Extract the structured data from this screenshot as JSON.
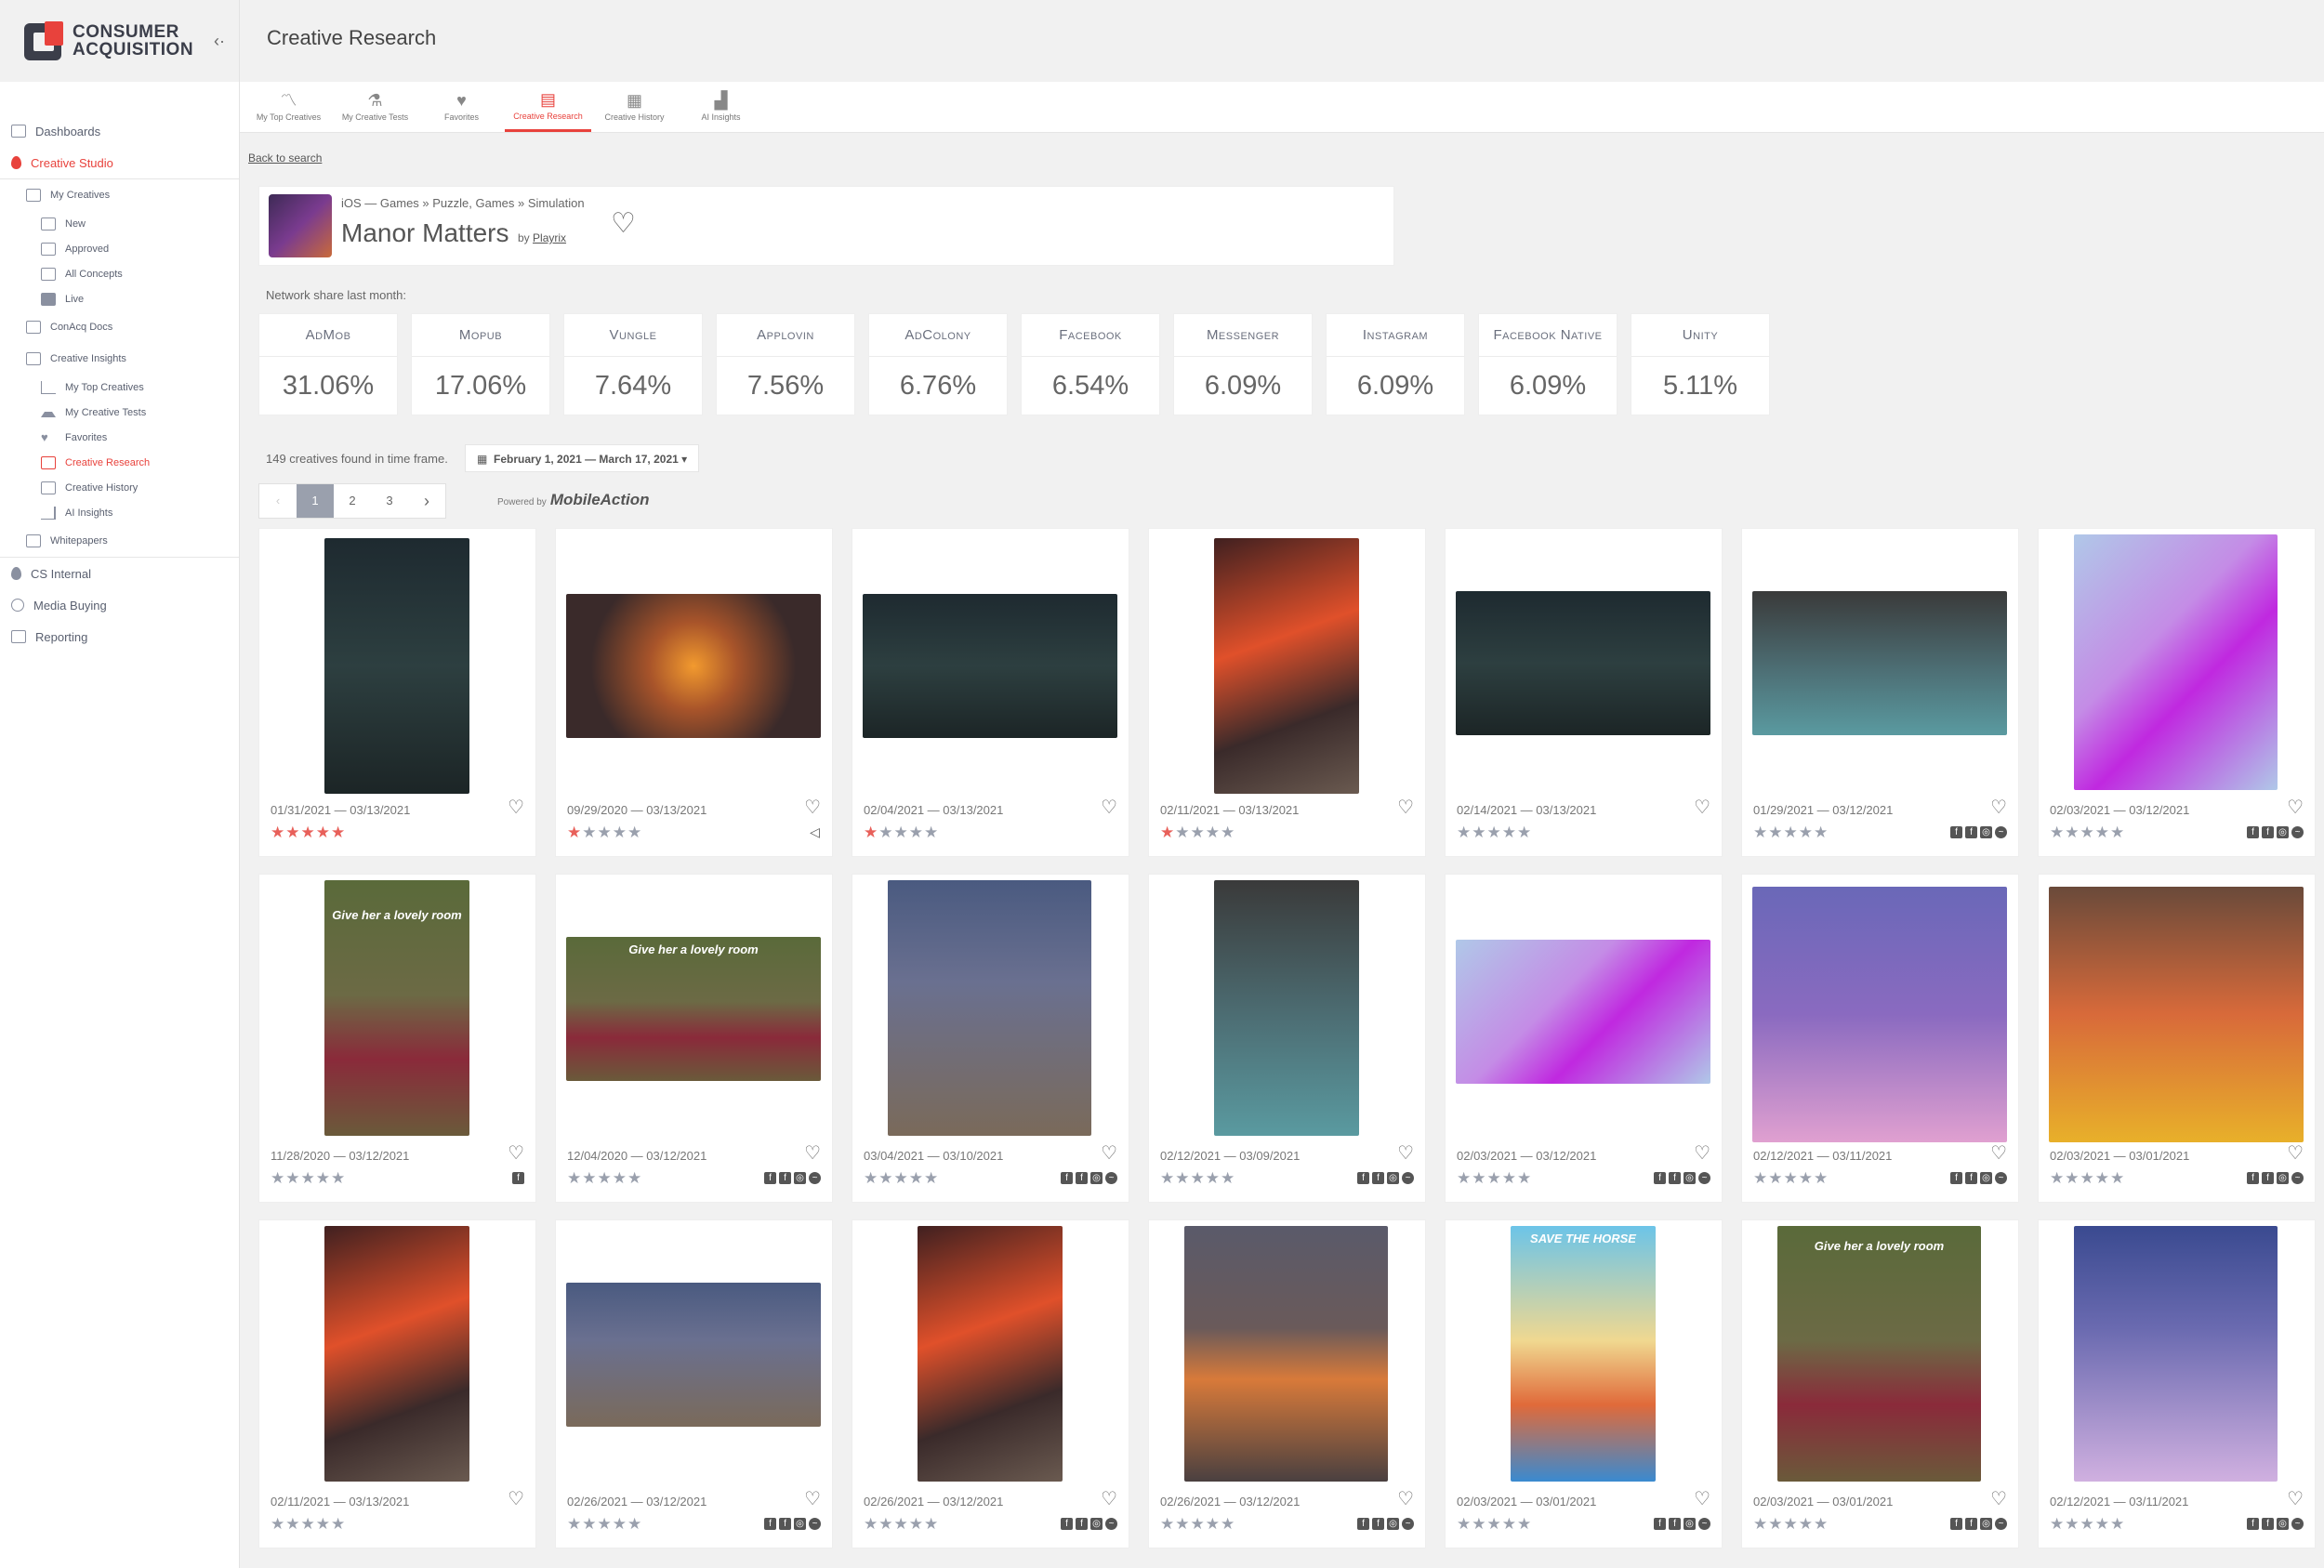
{
  "brand": {
    "line1": "CONSUMER",
    "line2": "ACQUISITION"
  },
  "page_title": "Creative Research",
  "sidebar": {
    "items": [
      {
        "label": "Dashboards"
      },
      {
        "label": "Creative Studio"
      },
      {
        "label": "My Creatives"
      },
      {
        "label": "New"
      },
      {
        "label": "Approved"
      },
      {
        "label": "All Concepts"
      },
      {
        "label": "Live"
      },
      {
        "label": "ConAcq Docs"
      },
      {
        "label": "Creative Insights"
      },
      {
        "label": "My Top Creatives"
      },
      {
        "label": "My Creative Tests"
      },
      {
        "label": "Favorites"
      },
      {
        "label": "Creative Research"
      },
      {
        "label": "Creative History"
      },
      {
        "label": "AI Insights"
      },
      {
        "label": "Whitepapers"
      },
      {
        "label": "CS Internal"
      },
      {
        "label": "Media Buying"
      },
      {
        "label": "Reporting"
      }
    ]
  },
  "tabs": [
    {
      "label": "My Top Creatives",
      "icon": "chart-line-icon"
    },
    {
      "label": "My Creative Tests",
      "icon": "flask-icon"
    },
    {
      "label": "Favorites",
      "icon": "heart-icon"
    },
    {
      "label": "Creative Research",
      "icon": "book-icon"
    },
    {
      "label": "Creative History",
      "icon": "calendar-icon"
    },
    {
      "label": "AI Insights",
      "icon": "bar-chart-icon"
    }
  ],
  "back_link": "Back to search",
  "app": {
    "breadcrumb": "iOS — Games » Puzzle, Games » Simulation",
    "name": "Manor Matters",
    "by_label": "by",
    "publisher": "Playrix"
  },
  "network_share": {
    "label": "Network share last month:",
    "items": [
      {
        "network": "AdMob",
        "value": "31.06%"
      },
      {
        "network": "Mopub",
        "value": "17.06%"
      },
      {
        "network": "Vungle",
        "value": "7.64%"
      },
      {
        "network": "Applovin",
        "value": "7.56%"
      },
      {
        "network": "AdColony",
        "value": "6.76%"
      },
      {
        "network": "Facebook",
        "value": "6.54%"
      },
      {
        "network": "Messenger",
        "value": "6.09%"
      },
      {
        "network": "Instagram",
        "value": "6.09%"
      },
      {
        "network": "Facebook Native",
        "value": "6.09%"
      },
      {
        "network": "Unity",
        "value": "5.11%"
      }
    ]
  },
  "results": {
    "found_text": "149 creatives found in time frame.",
    "date_range": "February 1, 2021 — March 17, 2021"
  },
  "pagination": {
    "pages": [
      "1",
      "2",
      "3"
    ],
    "current": "1"
  },
  "powered_by": {
    "label": "Powered by",
    "brand": "MobileAction"
  },
  "cards": [
    {
      "dates": "01/31/2021 — 03/13/2021",
      "stars": 5,
      "nets": []
    },
    {
      "dates": "09/29/2020 — 03/13/2021",
      "stars": 1,
      "nets": [
        "unity"
      ]
    },
    {
      "dates": "02/04/2021 — 03/13/2021",
      "stars": 1,
      "nets": []
    },
    {
      "dates": "02/11/2021 — 03/13/2021",
      "stars": 1,
      "nets": []
    },
    {
      "dates": "02/14/2021 — 03/13/2021",
      "stars": 0,
      "nets": []
    },
    {
      "dates": "01/29/2021 — 03/12/2021",
      "stars": 0,
      "nets": [
        "fb",
        "fb",
        "ig",
        "msg"
      ]
    },
    {
      "dates": "02/03/2021 — 03/12/2021",
      "stars": 0,
      "nets": [
        "fb",
        "fb",
        "ig",
        "msg"
      ]
    },
    {
      "dates": "11/28/2020 — 03/12/2021",
      "stars": 0,
      "nets": [
        "fb"
      ],
      "caption": "Give her a lovely room"
    },
    {
      "dates": "12/04/2020 — 03/12/2021",
      "stars": 0,
      "nets": [
        "fb",
        "fb",
        "ig",
        "msg"
      ],
      "caption": "Give her a lovely room"
    },
    {
      "dates": "03/04/2021 — 03/10/2021",
      "stars": 0,
      "nets": [
        "fb",
        "fb",
        "ig",
        "msg"
      ]
    },
    {
      "dates": "02/12/2021 — 03/09/2021",
      "stars": 0,
      "nets": [
        "fb",
        "fb",
        "ig",
        "msg"
      ]
    },
    {
      "dates": "02/03/2021 — 03/12/2021",
      "stars": 0,
      "nets": [
        "fb",
        "fb",
        "ig",
        "msg"
      ]
    },
    {
      "dates": "02/12/2021 — 03/11/2021",
      "stars": 0,
      "nets": [
        "fb",
        "fb",
        "ig",
        "msg"
      ]
    },
    {
      "dates": "02/03/2021 — 03/01/2021",
      "stars": 0,
      "nets": [
        "fb",
        "fb",
        "ig",
        "msg"
      ]
    },
    {
      "dates": "02/11/2021 — 03/13/2021",
      "stars": 0,
      "nets": []
    },
    {
      "dates": "02/26/2021 — 03/12/2021",
      "stars": 0,
      "nets": [
        "fb",
        "fb",
        "ig",
        "msg"
      ]
    },
    {
      "dates": "02/26/2021 — 03/12/2021",
      "stars": 0,
      "nets": [
        "fb",
        "fb",
        "ig",
        "msg"
      ]
    },
    {
      "dates": "02/26/2021 — 03/12/2021",
      "stars": 0,
      "nets": [
        "fb",
        "fb",
        "ig",
        "msg"
      ]
    },
    {
      "dates": "02/03/2021 — 03/01/2021",
      "stars": 0,
      "nets": [
        "fb",
        "fb",
        "ig",
        "msg"
      ],
      "caption": "SAVE THE HORSE"
    },
    {
      "dates": "02/03/2021 — 03/01/2021",
      "stars": 0,
      "nets": [
        "fb",
        "fb",
        "ig",
        "msg"
      ],
      "caption": "Give her a lovely room"
    },
    {
      "dates": "02/12/2021 — 03/11/2021",
      "stars": 0,
      "nets": [
        "fb",
        "fb",
        "ig",
        "msg"
      ]
    }
  ],
  "colors": {
    "accent": "#e8423c",
    "sidebar_bg": "#ffffff",
    "page_bg": "#f1f1f1"
  }
}
